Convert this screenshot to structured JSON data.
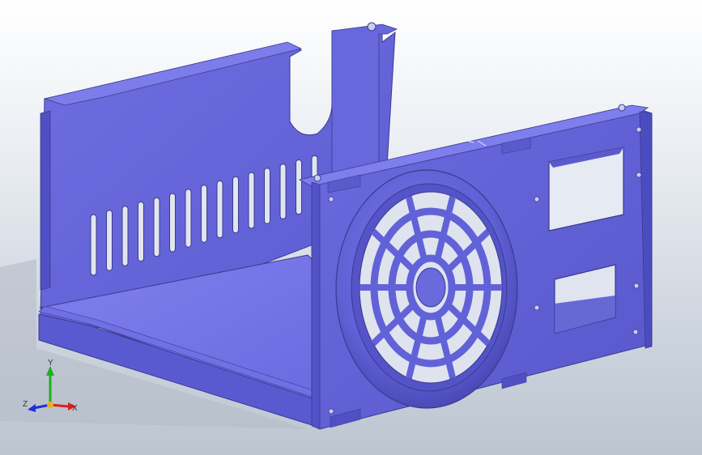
{
  "viewport": {
    "background_top": "#ffffff",
    "background_bottom": "#bcc5d0",
    "part_color": "#6666dd",
    "part_shadow": "#4b4bb8",
    "part_highlight": "#8a8af0"
  },
  "triad": {
    "x_label": "X",
    "y_label": "Y",
    "z_label": "Z",
    "x_color": "#d92020",
    "y_color": "#20b020",
    "z_color": "#2030d8"
  }
}
